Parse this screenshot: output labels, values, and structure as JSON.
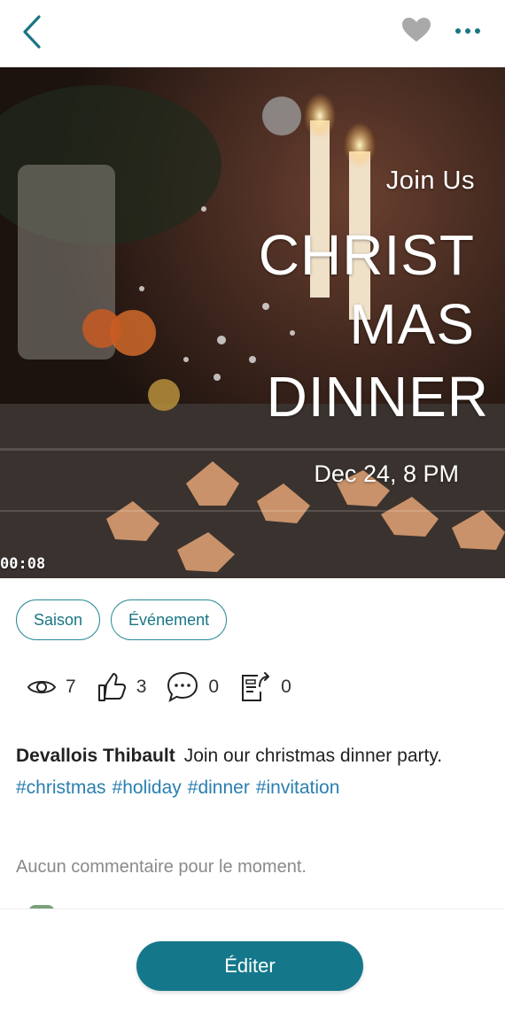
{
  "header": {
    "back_icon": "chevron-left-icon",
    "favorite_icon": "heart-icon",
    "more_icon": "more-horizontal-icon",
    "accent_color": "#1a7584"
  },
  "media": {
    "overlay": {
      "join": "Join Us",
      "title_line1": "CHRIST",
      "title_line2": "MAS",
      "title_line3": "DINNER",
      "date": "Dec 24, 8 PM"
    },
    "timer": "00:08"
  },
  "tags": [
    "Saison",
    "Événement"
  ],
  "stats": {
    "views": "7",
    "likes": "3",
    "comments": "0",
    "shares": "0"
  },
  "post": {
    "author": "Devallois Thibault",
    "text": "Join our christmas dinner party.",
    "hashtags": [
      "#christmas",
      "#holiday",
      "#dinner",
      "#invitation"
    ]
  },
  "comments": {
    "empty_text": "Aucun commentaire pour le moment."
  },
  "footer": {
    "edit_label": "Éditer",
    "button_color": "#14788a"
  }
}
